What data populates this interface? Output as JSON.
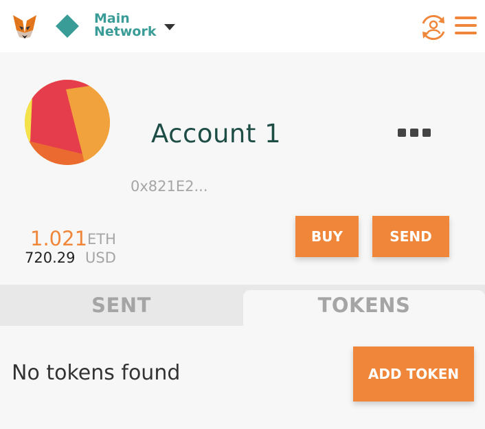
{
  "header": {
    "network_name": "Main\nNetwork",
    "colors": {
      "accent": "#f0863a",
      "network": "#3a9c96"
    },
    "icons": [
      "metamask-fox-icon",
      "network-diamond-icon",
      "chevron-down-icon",
      "account-switch-icon",
      "menu-icon"
    ]
  },
  "account": {
    "name": "Account 1",
    "address": "0x821E2...",
    "more_icon": "more-dots-icon"
  },
  "balance": {
    "eth_amount": "1.021",
    "eth_unit": "ETH",
    "usd_amount": "720.29",
    "usd_unit": "USD"
  },
  "actions": {
    "buy_label": "BUY",
    "send_label": "SEND"
  },
  "tabs": {
    "sent_label": "SENT",
    "tokens_label": "TOKENS",
    "active": "TOKENS"
  },
  "tokens": {
    "empty_text": "No tokens found",
    "add_token_label": "ADD TOKEN"
  }
}
